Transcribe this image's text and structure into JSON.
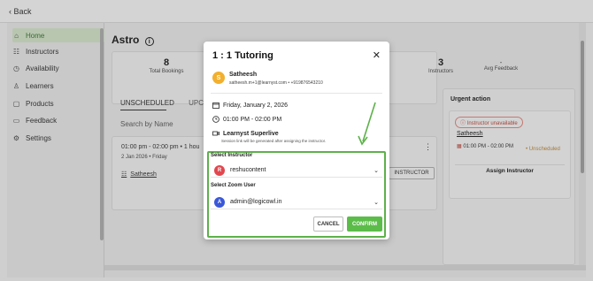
{
  "topbar": {
    "back_label": "Back"
  },
  "sidebar": {
    "items": [
      {
        "label": "Home",
        "icon": "home-icon",
        "active": true
      },
      {
        "label": "Instructors",
        "icon": "instructors-icon"
      },
      {
        "label": "Availability",
        "icon": "clock-icon"
      },
      {
        "label": "Learners",
        "icon": "person-icon"
      },
      {
        "label": "Products",
        "icon": "box-icon"
      },
      {
        "label": "Feedback",
        "icon": "chat-icon"
      },
      {
        "label": "Settings",
        "icon": "gear-icon"
      }
    ]
  },
  "main": {
    "title": "Astro",
    "stats": [
      {
        "value": "8",
        "label": "Total Bookings"
      },
      {
        "value": "3",
        "label": "Instructors"
      }
    ],
    "avg_feedback": {
      "value": "-",
      "label": "Avg Feedback"
    },
    "tabs": [
      "UNSCHEDULED",
      "UPCOMI"
    ],
    "search_placeholder": "Search by Name",
    "card": {
      "time": "01:00 pm - 02:00 pm • 1 hou",
      "date": "2 Jan 2026 • Friday",
      "instructor": "Satheesh",
      "assign_button": "INSTRUCTOR"
    }
  },
  "urgent": {
    "title": "Urgent action",
    "badge": "Instructor unavailable",
    "name": "Satheesh",
    "time": "01:00 PM - 02:00 PM",
    "status": "Unscheduled",
    "assign_button": "Assign Instructor"
  },
  "modal": {
    "title": "1 : 1 Tutoring",
    "close_icon": "close-icon",
    "student": {
      "initial": "S",
      "name": "Satheesh",
      "contact": "satheesh.m+1@learnyst.com • +919876543210"
    },
    "date": "Friday, January 2, 2026",
    "time": "01:00 PM - 02:00 PM",
    "platform": "Learnyst Superlive",
    "platform_note": "Session link will be generated after assigning the instructor.",
    "instructor_label": "Select Instructor",
    "instructor": {
      "initial": "R",
      "value": "reshucontent",
      "color": "#e0484e"
    },
    "zoom_label": "Select Zoom User",
    "zoom": {
      "initial": "A",
      "value": "admin@logicowl.in",
      "color": "#3a58d8"
    },
    "cancel_label": "CANCEL",
    "confirm_label": "CONFIRM"
  },
  "colors": {
    "accent_green": "#5cbc4a",
    "highlight_box": "#5db14a"
  }
}
